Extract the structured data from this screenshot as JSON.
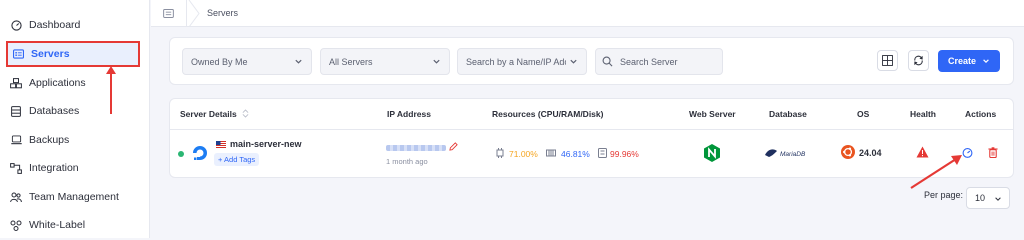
{
  "sidebar": {
    "items": [
      {
        "label": "Dashboard",
        "icon": "gauge-icon"
      },
      {
        "label": "Servers",
        "icon": "server-icon"
      },
      {
        "label": "Applications",
        "icon": "applications-icon"
      },
      {
        "label": "Databases",
        "icon": "database-icon"
      },
      {
        "label": "Backups",
        "icon": "backup-icon"
      },
      {
        "label": "Integration",
        "icon": "integration-icon"
      },
      {
        "label": "Team Management",
        "icon": "team-icon"
      },
      {
        "label": "White-Label",
        "icon": "white-label-icon"
      }
    ]
  },
  "breadcrumb": {
    "current": "Servers"
  },
  "filters": {
    "owner": "Owned By Me",
    "server_type": "All Servers",
    "search_by": "Search by a Name/IP Adc",
    "search_placeholder": "Search Server",
    "create_label": "Create"
  },
  "table": {
    "headers": {
      "details": "Server Details",
      "ip": "IP Address",
      "resources": "Resources (CPU/RAM/Disk)",
      "web_server": "Web Server",
      "database": "Database",
      "os": "OS",
      "health": "Health",
      "actions": "Actions"
    },
    "row": {
      "name": "main-server-new",
      "add_tags": "+ Add Tags",
      "ip_time": "1 month ago",
      "cpu": "71.00%",
      "ram": "46.81%",
      "disk": "99.96%",
      "database_name": "MariaDB",
      "os_version": "24.04"
    }
  },
  "pagination": {
    "label": "Per page:",
    "value": "10"
  },
  "colors": {
    "accent": "#2f66f6",
    "cpu": "#f5a623",
    "ram": "#2f66f6",
    "disk": "#e53935",
    "nginx": "#00963a",
    "ubuntu": "#e95420",
    "annotation": "#e53935"
  }
}
